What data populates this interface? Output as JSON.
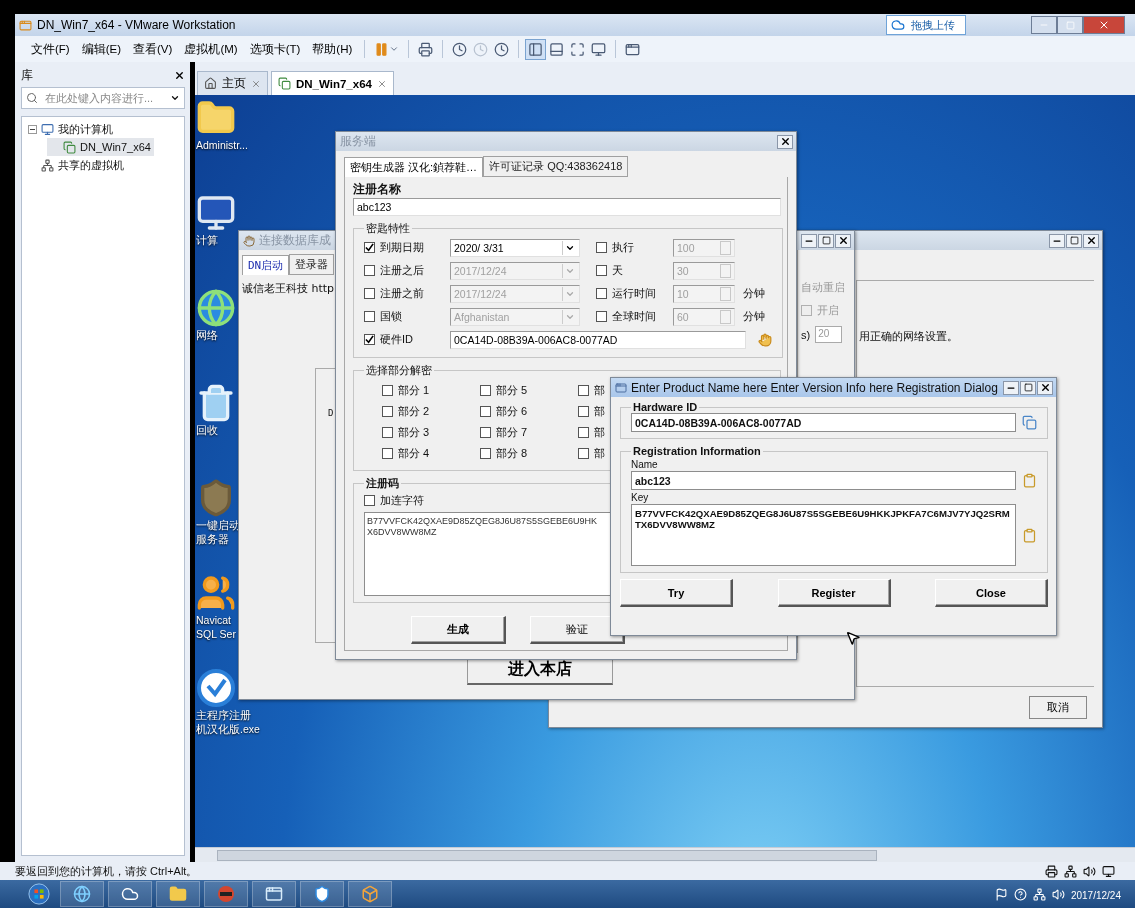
{
  "window": {
    "title": "DN_Win7_x64 - VMware Workstation",
    "upload_button": "拖拽上传"
  },
  "menu": [
    "文件(F)",
    "编辑(E)",
    "查看(V)",
    "虚拟机(M)",
    "选项卡(T)",
    "帮助(H)"
  ],
  "library": {
    "title": "库",
    "search": {
      "placeholder": "在此处键入内容进行..."
    },
    "tree": [
      {
        "label": "我的计算机",
        "kind": "computer",
        "expanded": true,
        "selected": false,
        "children": [
          {
            "label": "DN_Win7_x64",
            "kind": "vm",
            "selected": true
          }
        ]
      },
      {
        "label": "共享的虚拟机",
        "kind": "shared",
        "selected": false
      }
    ]
  },
  "tabs": [
    {
      "label": "主页",
      "kind": "home",
      "selected": false
    },
    {
      "label": "DN_Win7_x64",
      "kind": "vm",
      "selected": true
    }
  ],
  "desktop_icons": [
    {
      "kind": "user-folder",
      "lines": [
        "Administr..."
      ]
    },
    {
      "kind": "computer",
      "lines": [
        "计算"
      ]
    },
    {
      "kind": "network",
      "lines": [
        "网络"
      ]
    },
    {
      "kind": "recycle",
      "lines": [
        "回收"
      ]
    },
    {
      "kind": "game",
      "lines": [
        "一键启动",
        "服务器"
      ]
    },
    {
      "kind": "navicat",
      "lines": [
        "Navicat",
        "SQL Ser"
      ]
    },
    {
      "kind": "app",
      "lines": [
        "主程序注册",
        "机汉化版.exe"
      ]
    }
  ],
  "net_window": {
    "text": "用正确的网络设置。",
    "cancel_button": "取消"
  },
  "db_window": {
    "title": "连接数据库成",
    "tabs": [
      {
        "label": "DN启动",
        "selected": true
      },
      {
        "label": "登录器",
        "selected": false
      }
    ],
    "text": "诚信老王科技 http",
    "panel_text": "D",
    "restart": {
      "title": "自动重启",
      "checkbox": {
        "label": "开启",
        "checked": false,
        "disabled": true
      },
      "unit": "s)",
      "value": "20"
    },
    "enter_button": "进入本店"
  },
  "keygen": {
    "title": "服务端",
    "tabs": [
      {
        "label": "密钥生成器 汉化:鍞荐鞋…",
        "selected": true
      },
      {
        "label": "许可证记录 QQ:438362418",
        "selected": false
      }
    ],
    "name_label": "注册名称",
    "name": "abc123",
    "props_group": "密匙特性",
    "props": [
      {
        "label": "到期日期",
        "checked": true,
        "field": {
          "kind": "dropdown",
          "value": "2020/ 3/31",
          "disabled": false
        },
        "option": {
          "label": "执行",
          "checked": false,
          "value": "100",
          "disabled": true
        }
      },
      {
        "label": "注册之后",
        "checked": false,
        "field": {
          "kind": "dropdown",
          "value": "2017/12/24",
          "disabled": true
        },
        "option": {
          "label": "天",
          "checked": false,
          "value": "30",
          "disabled": true
        }
      },
      {
        "label": "注册之前",
        "checked": false,
        "field": {
          "kind": "dropdown",
          "value": "2017/12/24",
          "disabled": true
        },
        "option": {
          "label": "运行时间",
          "checked": false,
          "value": "10",
          "disabled": true,
          "unit": "分钟"
        }
      },
      {
        "label": "国锁",
        "checked": false,
        "field": {
          "kind": "dropdown",
          "value": "Afghanistan",
          "disabled": true
        },
        "option": {
          "label": "全球时间",
          "checked": false,
          "value": "60",
          "disabled": true,
          "unit": "分钟"
        }
      },
      {
        "label": "硬件ID",
        "checked": true,
        "field": {
          "kind": "text",
          "value": "0CA14D-08B39A-006AC8-0077AD",
          "disabled": false
        }
      }
    ],
    "parts_group": "选择部分解密",
    "parts_columns": [
      [
        {
          "label": "部分 1",
          "checked": false
        },
        {
          "label": "部分 2",
          "checked": false
        },
        {
          "label": "部分 3",
          "checked": false
        },
        {
          "label": "部分 4",
          "checked": false
        }
      ],
      [
        {
          "label": "部分 5",
          "checked": false
        },
        {
          "label": "部分 6",
          "checked": false
        },
        {
          "label": "部分 7",
          "checked": false
        },
        {
          "label": "部分 8",
          "checked": false
        }
      ],
      [
        {
          "label": "部",
          "checked": false
        },
        {
          "label": "部",
          "checked": false
        },
        {
          "label": "部",
          "checked": false
        },
        {
          "label": "部",
          "checked": false
        }
      ]
    ],
    "code_group": "注册码",
    "hyphen": {
      "label": "加连字符",
      "checked": false
    },
    "code": "B77VVFCK42QXAE9D85ZQEG8J6U87S5SGEBE6U9HK\nX6DVV8WW8MZ",
    "buttons": [
      "生成",
      "验证"
    ]
  },
  "reg_dialog": {
    "title": "Enter Product Name here Enter Version Info here Registration Dialog",
    "hardware_group": "Hardware ID",
    "hardware_id": "0CA14D-08B39A-006AC8-0077AD",
    "info_group": "Registration Information",
    "name_label": "Name",
    "name": "abc123",
    "key_label": "Key",
    "key": "B77VVFCK42QXAE9D85ZQEG8J6U87S5SGEBE6U9HKKJPKFA7C6MJV7YJQ2SRMTX6DVV8WW8MZ",
    "buttons": [
      "Try",
      "Register",
      "Close"
    ]
  },
  "status_bar": {
    "text": "要返回到您的计算机，请按 Ctrl+Alt。"
  },
  "taskbar": {
    "date": "2017/12/24"
  }
}
